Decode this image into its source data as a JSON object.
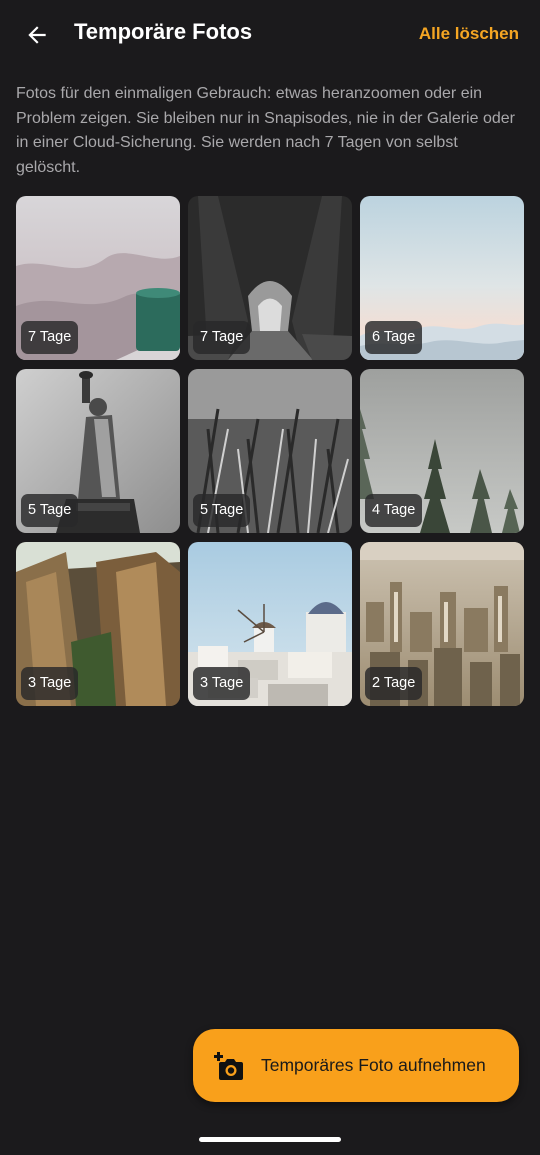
{
  "header": {
    "title": "Temporäre Fotos",
    "clear_all_label": "Alle löschen"
  },
  "description": "Fotos für den einmaligen Gebrauch: etwas heranzoomen oder ein Problem zeigen. Sie bleiben nur in Snapisodes, nie in der Galerie oder in einer Cloud-Sicherung. Sie werden nach 7 Tagen von selbst gelöscht.",
  "photos": [
    {
      "days_left": "7 Tage",
      "subject": "mug"
    },
    {
      "days_left": "7 Tage",
      "subject": "tree-tunnel"
    },
    {
      "days_left": "6 Tage",
      "subject": "sky-clouds"
    },
    {
      "days_left": "5 Tage",
      "subject": "statue"
    },
    {
      "days_left": "5 Tage",
      "subject": "grass"
    },
    {
      "days_left": "4 Tage",
      "subject": "foggy-forest"
    },
    {
      "days_left": "3 Tage",
      "subject": "rocks"
    },
    {
      "days_left": "3 Tage",
      "subject": "windmill-village"
    },
    {
      "days_left": "2 Tage",
      "subject": "city"
    }
  ],
  "fab": {
    "label": "Temporäres Foto aufnehmen",
    "icon": "add-camera-icon"
  },
  "colors": {
    "background": "#1b1a1c",
    "accent": "#f5a623",
    "fab": "#f9a01b"
  }
}
